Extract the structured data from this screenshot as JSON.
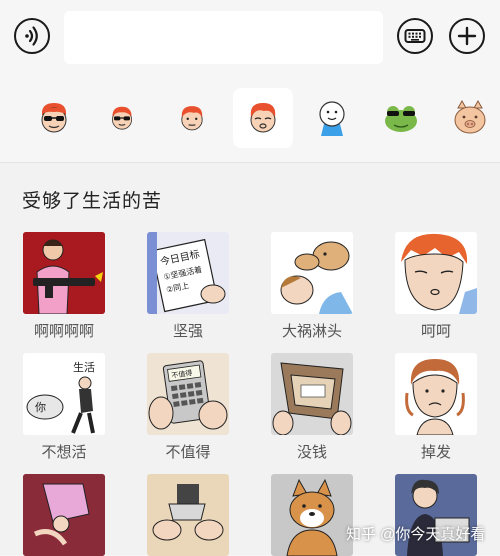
{
  "input_bar": {
    "voice_icon": "voice-wave-icon",
    "keyboard_icon": "keyboard-icon",
    "plus_icon": "plus-icon",
    "text_value": ""
  },
  "sticker_tabs": [
    {
      "name": "tab-sunglasses-guy",
      "icon": "sunglasses-face-icon",
      "active": false
    },
    {
      "name": "tab-sunglasses-small",
      "icon": "sunglasses-face-small-icon",
      "active": false
    },
    {
      "name": "tab-redhead-face",
      "icon": "redhead-face-icon",
      "active": false
    },
    {
      "name": "tab-tired-face",
      "icon": "tired-face-icon",
      "active": true
    },
    {
      "name": "tab-blue-character",
      "icon": "blue-character-icon",
      "active": false
    },
    {
      "name": "tab-frog",
      "icon": "frog-icon",
      "active": false
    },
    {
      "name": "tab-pig",
      "icon": "pig-icon",
      "active": false
    }
  ],
  "section": {
    "title": "受够了生活的苦"
  },
  "stickers": [
    {
      "label": "啊啊啊啊",
      "icon": "gun-man-sticker-icon"
    },
    {
      "label": "坚强",
      "icon": "notebook-goal-sticker-icon",
      "text": [
        "今日目标",
        "①坚强活着",
        "②同上"
      ]
    },
    {
      "label": "大祸淋头",
      "icon": "dog-on-head-sticker-icon"
    },
    {
      "label": "呵呵",
      "icon": "smirk-face-sticker-icon"
    },
    {
      "label": "不想活",
      "icon": "kneeling-man-sticker-icon",
      "text": [
        "生活",
        "你"
      ]
    },
    {
      "label": "不值得",
      "icon": "calculator-sticker-icon",
      "text": [
        "不值得"
      ]
    },
    {
      "label": "没钱",
      "icon": "empty-wallet-sticker-icon"
    },
    {
      "label": "掉发",
      "icon": "hair-loss-sticker-icon"
    },
    {
      "label": "",
      "icon": "falling-person-sticker-icon"
    },
    {
      "label": "",
      "icon": "cutting-card-sticker-icon"
    },
    {
      "label": "",
      "icon": "shiba-dog-sticker-icon"
    },
    {
      "label": "",
      "icon": "laptop-girl-sticker-icon"
    }
  ],
  "watermark": "知乎 @你今天真好看",
  "colors": {
    "background": "#f6f6f6",
    "panel": "#f2f2f2",
    "label": "#555555"
  }
}
